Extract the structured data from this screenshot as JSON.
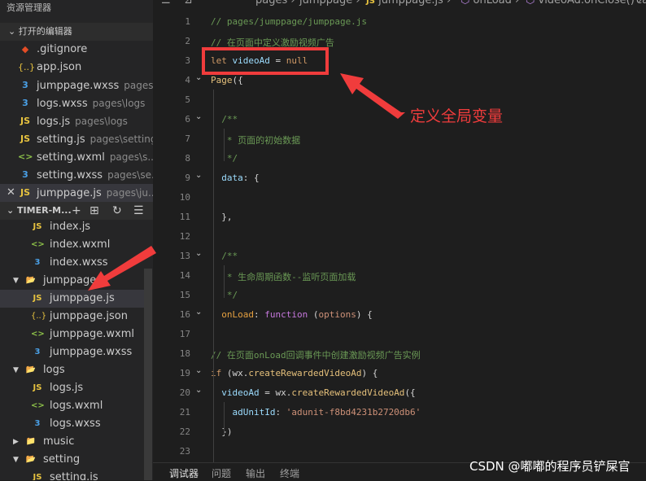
{
  "sidebar": {
    "title": "资源管理器",
    "open_editors_header": "打开的编辑器",
    "open_editors": [
      {
        "icon": "◆",
        "name": ".gitignore",
        "path": ""
      },
      {
        "icon": "{..}",
        "name": "app.json",
        "path": ""
      },
      {
        "icon": "3",
        "name": "jumppage.wxss",
        "path": "pages\\..."
      },
      {
        "icon": "3",
        "name": "logs.wxss",
        "path": "pages\\logs"
      },
      {
        "icon": "JS",
        "name": "logs.js",
        "path": "pages\\logs"
      },
      {
        "icon": "JS",
        "name": "setting.js",
        "path": "pages\\setting"
      },
      {
        "icon": "<>",
        "name": "setting.wxml",
        "path": "pages\\s..."
      },
      {
        "icon": "3",
        "name": "setting.wxss",
        "path": "pages\\se..."
      },
      {
        "icon": "JS",
        "name": "jumppage.js",
        "path": "pages\\ju...",
        "close": "✕"
      }
    ],
    "project_header": "TIMER-M...",
    "project_actions": [
      "+",
      "⊞",
      "↻",
      "☰"
    ],
    "tree": [
      {
        "icon": "JS",
        "name": "index.js"
      },
      {
        "icon": "<>",
        "name": "index.wxml"
      },
      {
        "icon": "3",
        "name": "index.wxss"
      },
      {
        "arrow": "▼",
        "icon": "📂",
        "name": "jumppage"
      },
      {
        "icon": "JS",
        "name": "jumppage.js"
      },
      {
        "icon": "{..}",
        "name": "jumppage.json"
      },
      {
        "icon": "<>",
        "name": "jumppage.wxml"
      },
      {
        "icon": "3",
        "name": "jumppage.wxss"
      },
      {
        "arrow": "▼",
        "icon": "📂",
        "name": "logs"
      },
      {
        "icon": "JS",
        "name": "logs.js"
      },
      {
        "icon": "<>",
        "name": "logs.wxml"
      },
      {
        "icon": "3",
        "name": "logs.wxss"
      },
      {
        "arrow": "▶",
        "icon": "📁",
        "name": "music"
      },
      {
        "arrow": "▼",
        "icon": "📂",
        "name": "setting"
      },
      {
        "icon": "JS",
        "name": "setting.js"
      }
    ]
  },
  "breadcrumb": {
    "menu_icon": "☰",
    "bookmark_icon": "⊿",
    "items": [
      "pages",
      "jumppage",
      "jumppage.js",
      "onLoad",
      "videoAd.onClose()",
      "ca"
    ]
  },
  "editor": {
    "lines": [
      {
        "num": "1",
        "fold": "",
        "tokens": [
          [
            "cmt",
            "// pages/jumppage/jumppage.js"
          ]
        ]
      },
      {
        "num": "2",
        "fold": "",
        "tokens": [
          [
            "cmt",
            "// 在页面中定义激励视频广告"
          ]
        ]
      },
      {
        "num": "3",
        "fold": "",
        "tokens": [
          [
            "kw",
            "let "
          ],
          [
            "id",
            "videoAd "
          ],
          [
            "punc",
            "= "
          ],
          [
            "kw",
            "null"
          ]
        ]
      },
      {
        "num": "4",
        "fold": "⌄",
        "tokens": [
          [
            "fn",
            "Page"
          ],
          [
            "punc",
            "({"
          ]
        ]
      },
      {
        "num": "5",
        "fold": "",
        "tokens": []
      },
      {
        "num": "6",
        "fold": "⌄",
        "tokens": [
          [
            "cmt",
            "  /**"
          ]
        ]
      },
      {
        "num": "7",
        "fold": "",
        "tokens": [
          [
            "cmt",
            "   * 页面的初始数据"
          ]
        ]
      },
      {
        "num": "8",
        "fold": "",
        "tokens": [
          [
            "cmt",
            "   */"
          ]
        ]
      },
      {
        "num": "9",
        "fold": "⌄",
        "tokens": [
          [
            "id",
            "  data"
          ],
          [
            "punc",
            ": {"
          ]
        ]
      },
      {
        "num": "10",
        "fold": "",
        "tokens": []
      },
      {
        "num": "11",
        "fold": "",
        "tokens": [
          [
            "punc",
            "  },"
          ]
        ]
      },
      {
        "num": "12",
        "fold": "",
        "tokens": []
      },
      {
        "num": "13",
        "fold": "⌄",
        "tokens": [
          [
            "cmt",
            "  /**"
          ]
        ]
      },
      {
        "num": "14",
        "fold": "",
        "tokens": [
          [
            "cmt",
            "   * 生命周期函数--监听页面加载"
          ]
        ]
      },
      {
        "num": "15",
        "fold": "",
        "tokens": [
          [
            "cmt",
            "   */"
          ]
        ]
      },
      {
        "num": "16",
        "fold": "⌄",
        "tokens": [
          [
            "orange",
            "  onLoad"
          ],
          [
            "punc",
            ": "
          ],
          [
            "kw2",
            "function "
          ],
          [
            "punc",
            "("
          ],
          [
            "str",
            "options"
          ],
          [
            "punc",
            ") {"
          ]
        ]
      },
      {
        "num": "17",
        "fold": "",
        "tokens": []
      },
      {
        "num": "18",
        "fold": "",
        "tokens": [
          [
            "cmt",
            "// 在页面onLoad回调事件中创建激励视频广告实例"
          ]
        ]
      },
      {
        "num": "19",
        "fold": "⌄",
        "tokens": [
          [
            "kw",
            "if "
          ],
          [
            "punc",
            "(wx."
          ],
          [
            "fn",
            "createRewardedVideoAd"
          ],
          [
            "punc",
            ") {"
          ]
        ]
      },
      {
        "num": "20",
        "fold": "⌄",
        "tokens": [
          [
            "id",
            "  videoAd "
          ],
          [
            "punc",
            "= wx."
          ],
          [
            "fn",
            "createRewardedVideoAd"
          ],
          [
            "punc",
            "({"
          ]
        ]
      },
      {
        "num": "21",
        "fold": "",
        "tokens": [
          [
            "id",
            "    adUnitId"
          ],
          [
            "punc",
            ": "
          ],
          [
            "str",
            "'adunit-f8bd4231b2720db6'"
          ]
        ]
      },
      {
        "num": "22",
        "fold": "",
        "tokens": [
          [
            "punc",
            "  })"
          ]
        ]
      },
      {
        "num": "23",
        "fold": "",
        "tokens": []
      }
    ]
  },
  "annotation": {
    "text": "定义全局变量",
    "color": "#f03c3c"
  },
  "bottom_panel": {
    "tabs": [
      "调试器",
      "问题",
      "输出",
      "终端"
    ]
  },
  "watermark": "CSDN @嘟嘟的程序员铲屎官"
}
